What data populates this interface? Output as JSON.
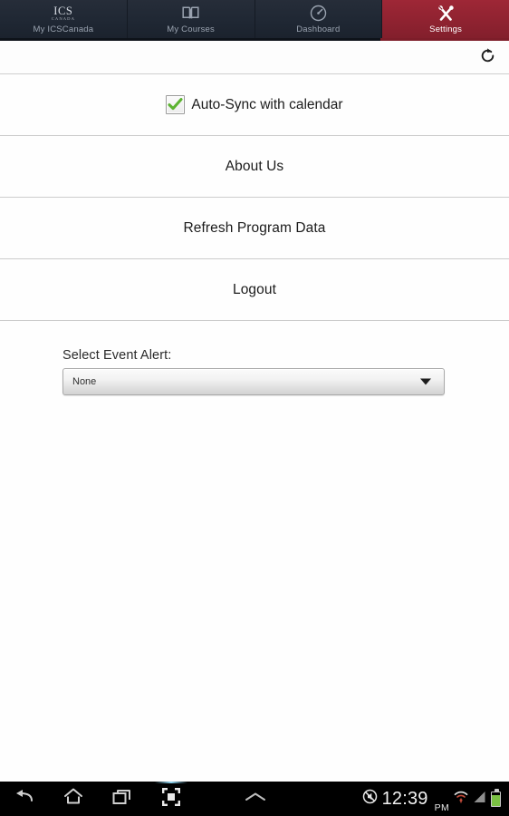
{
  "tabbar": {
    "tabs": [
      {
        "label": "My ICSCanada",
        "icon": "ics-canada-logo",
        "active": false,
        "logo_main": "ICS",
        "logo_sub": "CANADA"
      },
      {
        "label": "My Courses",
        "icon": "book-icon",
        "active": false
      },
      {
        "label": "Dashboard",
        "icon": "gauge-icon",
        "active": false
      },
      {
        "label": "Settings",
        "icon": "tools-icon",
        "active": true
      }
    ],
    "active_color": "#8e2230",
    "inactive_color": "#1f2733"
  },
  "actionbar": {
    "refresh_icon": "refresh-icon"
  },
  "settings": {
    "auto_sync": {
      "label": "Auto-Sync with calendar",
      "checked": true,
      "check_color": "#5cb331"
    },
    "rows": [
      {
        "label": "About Us"
      },
      {
        "label": "Refresh Program Data"
      },
      {
        "label": "Logout"
      }
    ]
  },
  "event_alert": {
    "label": "Select Event Alert:",
    "value": "None",
    "options": [
      "None"
    ],
    "arrow_icon": "chevron-down-icon"
  },
  "systembar": {
    "nav": [
      {
        "name": "back",
        "icon": "back-arrow-icon"
      },
      {
        "name": "home",
        "icon": "home-icon"
      },
      {
        "name": "recents",
        "icon": "recent-apps-icon"
      },
      {
        "name": "screenshot",
        "icon": "screenshot-icon"
      },
      {
        "name": "expand",
        "icon": "chevron-up-icon"
      }
    ],
    "status": {
      "silent_icon": "mute-icon",
      "time": "12:39",
      "ampm": "PM",
      "wifi_icon": "wifi-icon",
      "signal_icon": "signal-bars-icon",
      "battery_icon": "battery-icon",
      "battery_color": "#7ac143"
    }
  }
}
